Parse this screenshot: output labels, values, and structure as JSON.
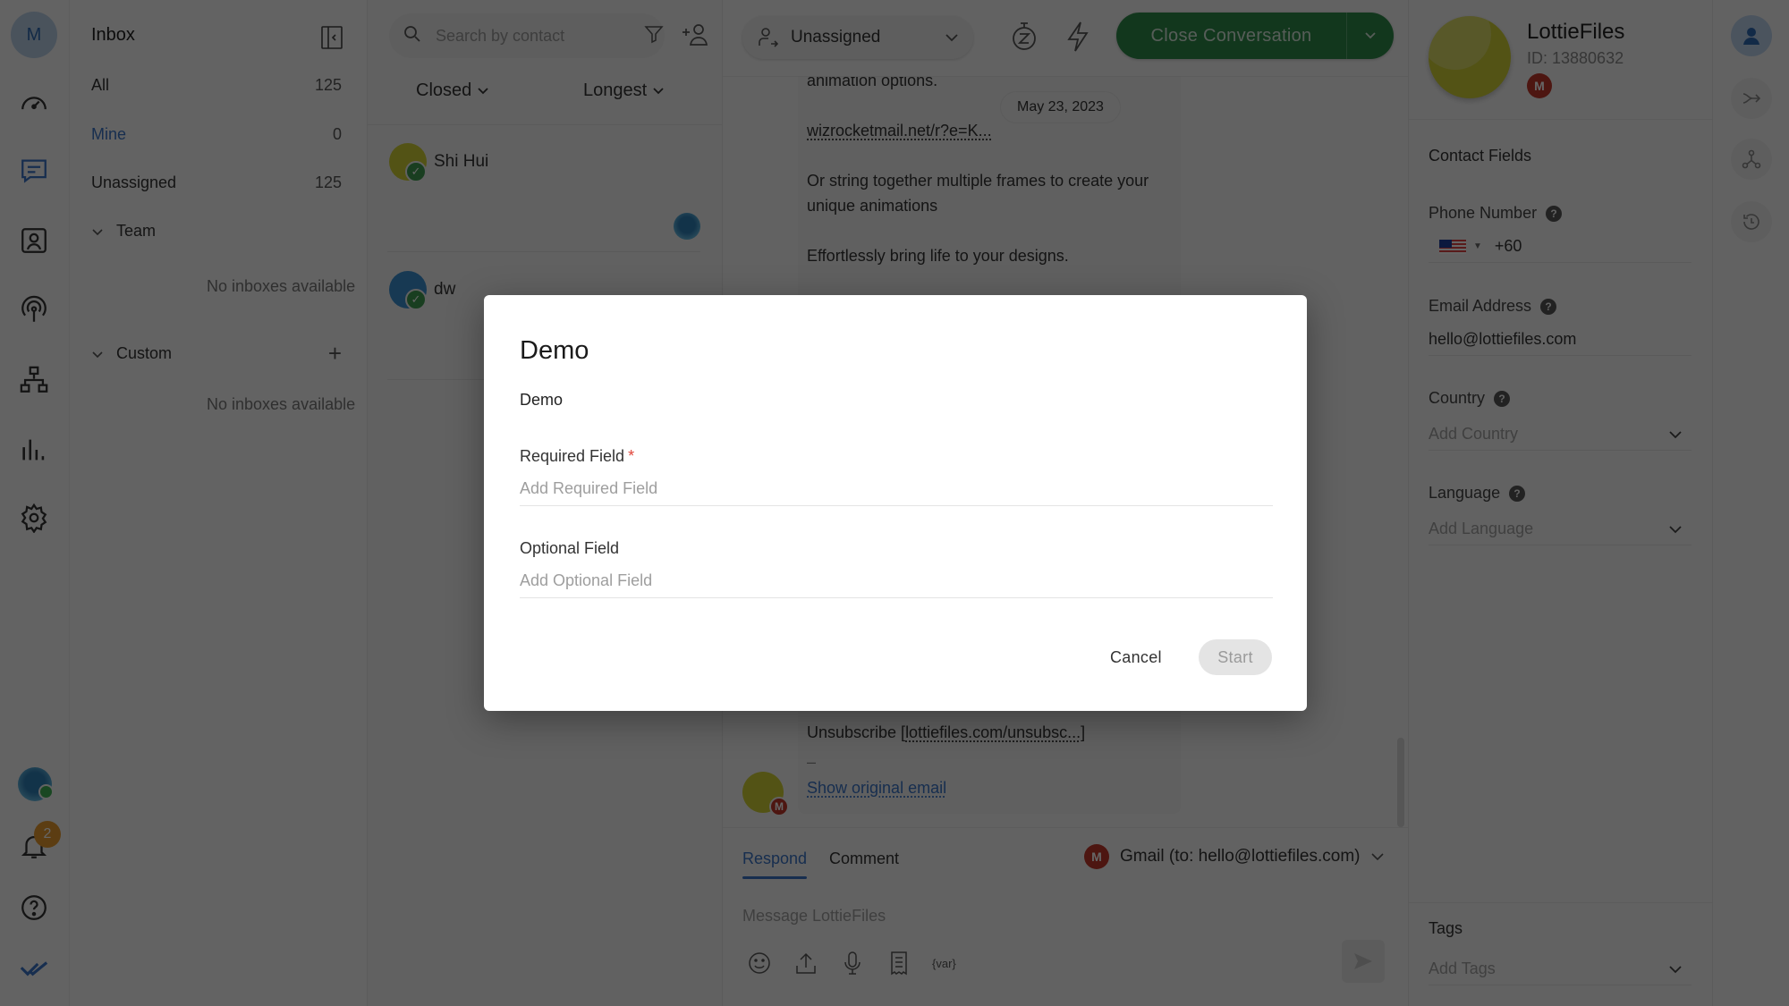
{
  "rail": {
    "user_initial": "M",
    "notification_count": "2",
    "items": [
      "dashboard",
      "conversations",
      "contacts",
      "broadcasts",
      "workflows",
      "reports",
      "settings"
    ],
    "accent": "#3a74c6"
  },
  "inbox": {
    "title": "Inbox",
    "views": [
      {
        "label": "All",
        "count": "125"
      },
      {
        "label": "Mine",
        "count": "0",
        "active": true
      },
      {
        "label": "Unassigned",
        "count": "125"
      }
    ],
    "groups": [
      {
        "label": "Team",
        "empty_text": "No inboxes available"
      },
      {
        "label": "Custom",
        "empty_text": "No inboxes available"
      }
    ]
  },
  "convlist": {
    "search_placeholder": "Search by contact",
    "status_filter": "Closed",
    "sort": "Longest",
    "conversations": [
      {
        "name": "Shi Hui",
        "status": "closed",
        "avatar_color": "#cfcf35"
      },
      {
        "name": "dw",
        "status": "closed",
        "avatar_color": "#3b8fd0"
      }
    ]
  },
  "chat": {
    "assignee": "Unassigned",
    "close_label": "Close Conversation",
    "date_chip": "May 23, 2023",
    "message_lines": {
      "l1": "animation options.",
      "link1": "wizrocketmail.net/r?e=K...",
      "l2": "Or string together multiple frames to create your unique animations",
      "l3": "Effortlessly bring life to your designs.",
      "unsub_prefix": "Unsubscribe [",
      "unsub_link": "lottiefiles.com/unsubsc...",
      "unsub_suffix": "]",
      "dash": "–",
      "show_original": "Show original email"
    },
    "composer": {
      "tab_respond": "Respond",
      "tab_comment": "Comment",
      "channel": "Gmail (to: hello@lottiefiles.com)",
      "placeholder": "Message LottieFiles",
      "var_label": "{var}"
    },
    "close_color": "#2f8a4a"
  },
  "contact": {
    "name": "LottieFiles",
    "id_label": "ID: 13880632",
    "channel_badge": "M",
    "section_title": "Contact Fields",
    "fields": {
      "phone_label": "Phone Number",
      "phone_value": "+60",
      "email_label": "Email Address",
      "email_value": "hello@lottiefiles.com",
      "country_label": "Country",
      "country_placeholder": "Add Country",
      "language_label": "Language",
      "language_placeholder": "Add Language"
    },
    "tags_title": "Tags",
    "tags_placeholder": "Add Tags"
  },
  "modal": {
    "title": "Demo",
    "description": "Demo",
    "required_label": "Required Field",
    "required_marker": "*",
    "required_placeholder": "Add Required Field",
    "optional_label": "Optional Field",
    "optional_placeholder": "Add Optional Field",
    "cancel_label": "Cancel",
    "start_label": "Start"
  }
}
